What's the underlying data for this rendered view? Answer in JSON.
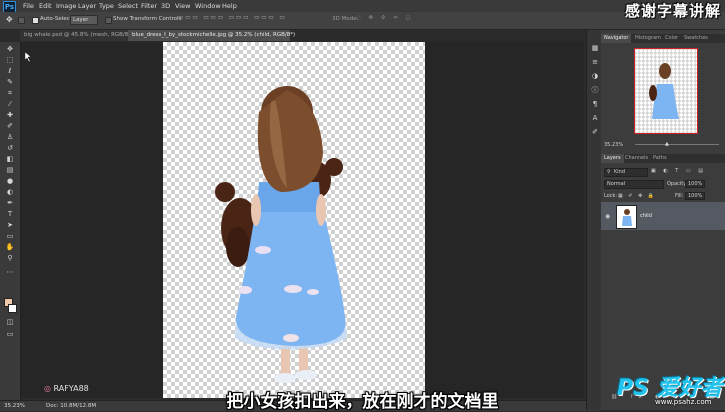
{
  "app": {
    "logo": "Ps"
  },
  "menu": [
    "File",
    "Edit",
    "Image",
    "Layer",
    "Type",
    "Select",
    "Filter",
    "3D",
    "View",
    "Window",
    "Help"
  ],
  "options": {
    "auto_select_label": "Auto-Select:",
    "auto_select_value": "Layer",
    "show_transform_label": "Show Transform Controls",
    "mode_3d_label": "3D Mode:"
  },
  "tabs": [
    {
      "label": "big whale.psd @ 45.8% (mesh, RGB/8)",
      "active": false
    },
    {
      "label": "blue_dress_I_by_stockmichelle.jpg @ 35.2% (child, RGB/8*)",
      "active": true
    }
  ],
  "status": {
    "zoom": "35.23%",
    "doc": "Doc: 10.8M/12.8M"
  },
  "navigator": {
    "tabs": [
      "Navigator",
      "Histogram",
      "Color",
      "Swatches"
    ],
    "zoom": "35.23%"
  },
  "layers": {
    "tabs": [
      "Layers",
      "Channels",
      "Paths"
    ],
    "filter_label": "Kind",
    "blend_mode": "Normal",
    "opacity_label": "Opacity:",
    "opacity": "100%",
    "lock_label": "Lock:",
    "fill_label": "Fill:",
    "fill": "100%",
    "items": [
      {
        "name": "child",
        "visible": true
      }
    ]
  },
  "overlay": {
    "corner_title": "感谢字幕讲解",
    "subtitle": "把小女孩扣出来，放在刚才的文档里",
    "instagram": "RAFYA88",
    "watermark": "PS 爱好者",
    "watermark_url": "www.psahz.com"
  },
  "colors": {
    "accent": "#2f8fd8",
    "watermark": "#22c4ee",
    "foreground_swatch": "#f0c9a8"
  },
  "toolbar_icons": [
    "move-icon",
    "marquee-icon",
    "lasso-icon",
    "quick-select-icon",
    "crop-icon",
    "eyedropper-icon",
    "healing-icon",
    "brush-icon",
    "stamp-icon",
    "history-brush-icon",
    "eraser-icon",
    "gradient-icon",
    "blur-icon",
    "dodge-icon",
    "pen-icon",
    "type-icon",
    "path-select-icon",
    "shape-icon",
    "hand-icon",
    "zoom-icon"
  ]
}
